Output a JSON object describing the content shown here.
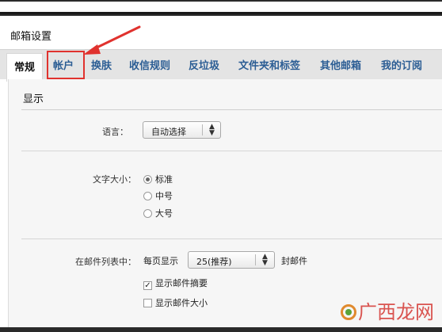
{
  "window": {
    "title": "邮箱设置"
  },
  "tabs": [
    {
      "label": "常规",
      "active": true
    },
    {
      "label": "帐户",
      "active": false,
      "highlighted": true
    },
    {
      "label": "换肤",
      "active": false
    },
    {
      "label": "收信规则",
      "active": false
    },
    {
      "label": "反垃圾",
      "active": false
    },
    {
      "label": "文件夹和标签",
      "active": false
    },
    {
      "label": "其他邮箱",
      "active": false
    },
    {
      "label": "我的订阅",
      "active": false
    }
  ],
  "display_section": {
    "title": "显示",
    "language": {
      "label": "语言：",
      "selected": "自动选择"
    },
    "font_size": {
      "label": "文字大小：",
      "options": [
        {
          "label": "标准",
          "selected": true
        },
        {
          "label": "中号",
          "selected": false
        },
        {
          "label": "大号",
          "selected": false
        }
      ]
    },
    "mail_list": {
      "label": "在邮件列表中：",
      "per_page_prefix": "每页显示",
      "per_page_value": "25(推荐)",
      "per_page_suffix": "封邮件",
      "show_summary": {
        "label": "显示邮件摘要",
        "checked": true
      },
      "show_size": {
        "label": "显示邮件大小",
        "checked": false
      }
    }
  },
  "watermark": {
    "text": "广西龙网"
  },
  "colors": {
    "tab_link": "#2b5d94",
    "highlight": "#e0322e",
    "tab_bar": "#e4e4e4"
  }
}
